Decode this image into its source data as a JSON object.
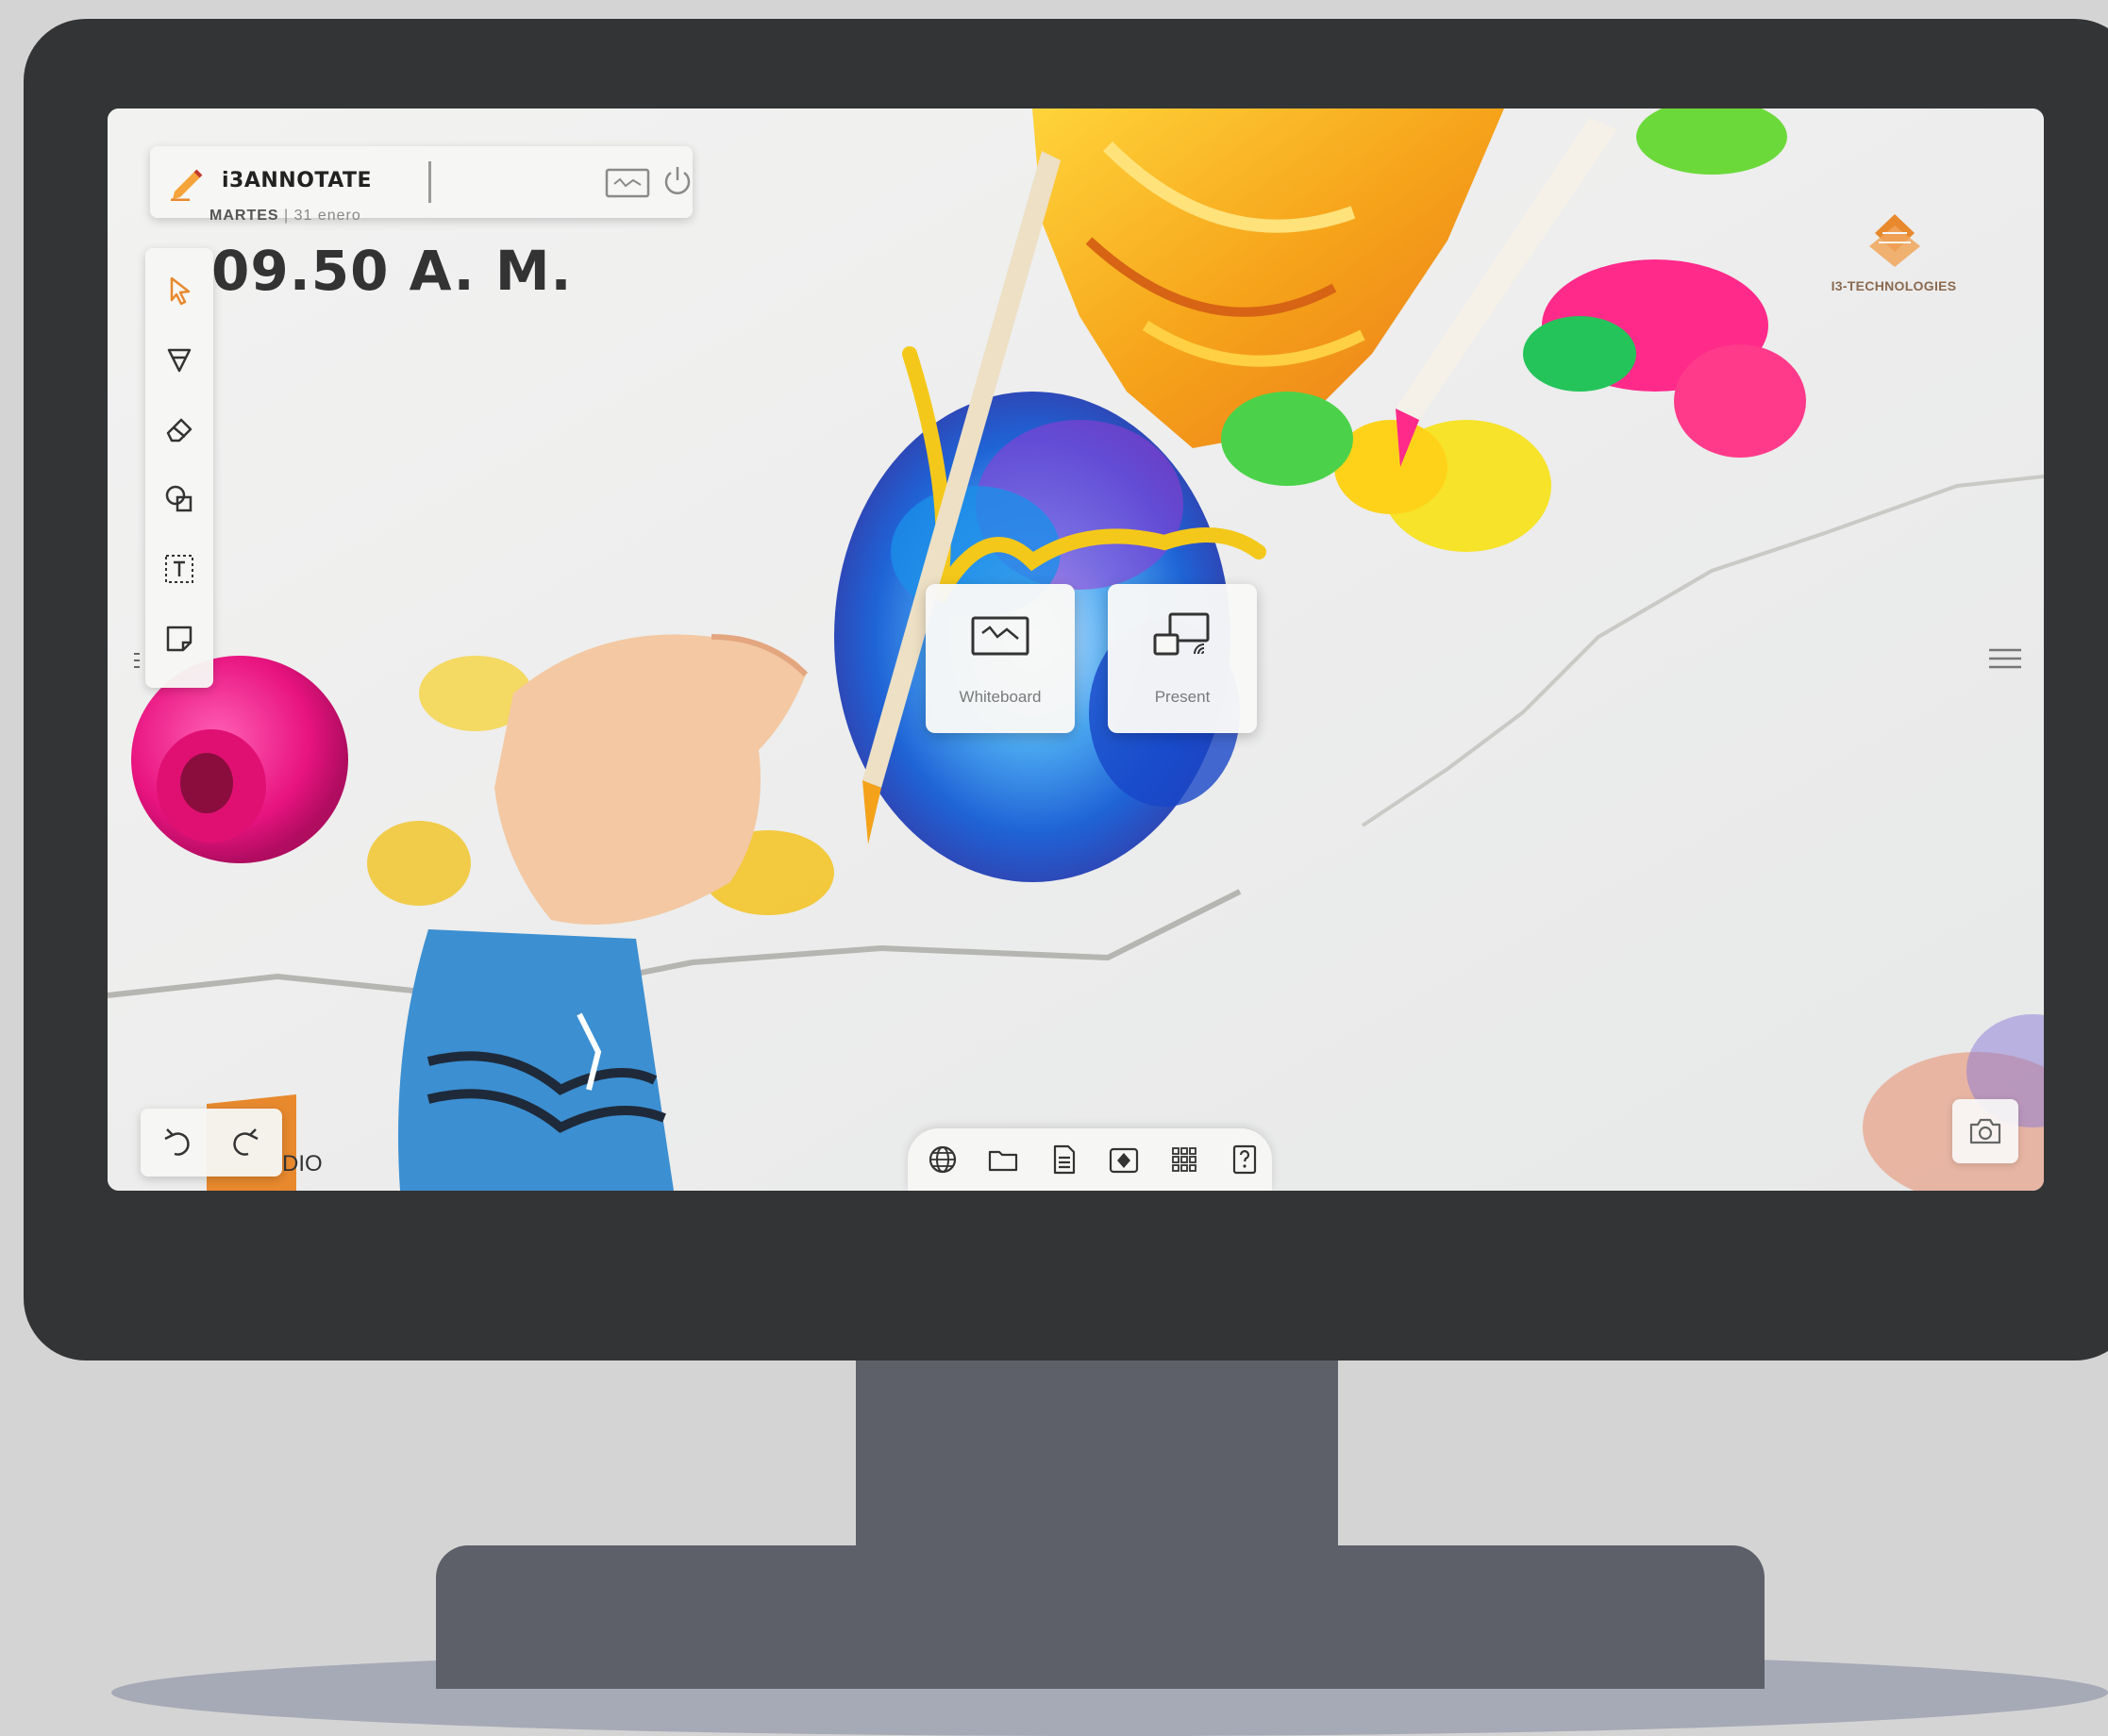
{
  "annotate_bar": {
    "title": "i3ANNOTATE"
  },
  "home": {
    "date_day": "MARTES",
    "date_rest": "| 31 enero",
    "time": "09.50 A. M."
  },
  "tools": [
    {
      "name": "select",
      "icon": "pointer-icon",
      "active": true
    },
    {
      "name": "pen",
      "icon": "pen-tool-icon"
    },
    {
      "name": "eraser",
      "icon": "eraser-icon"
    },
    {
      "name": "shapes",
      "icon": "shapes-icon"
    },
    {
      "name": "text",
      "icon": "text-box-icon"
    },
    {
      "name": "note",
      "icon": "sticky-note-icon"
    }
  ],
  "apps": {
    "whiteboard_label": "Whiteboard",
    "present_label": "Present"
  },
  "brand": {
    "name": "I3-TECHNOLOGIES",
    "color": "#e8892e"
  },
  "studio_partial": "DIO",
  "dock": [
    {
      "name": "browser",
      "icon": "globe-icon"
    },
    {
      "name": "files",
      "icon": "folder-icon"
    },
    {
      "name": "documents",
      "icon": "document-icon"
    },
    {
      "name": "capture",
      "icon": "camera-box-icon"
    },
    {
      "name": "apps",
      "icon": "app-grid-icon"
    },
    {
      "name": "help",
      "icon": "help-icon"
    }
  ],
  "colors": {
    "accent": "#e8892e",
    "bezel": "#333436",
    "stand": "#5d6069",
    "panel": "#f6f6f4"
  }
}
